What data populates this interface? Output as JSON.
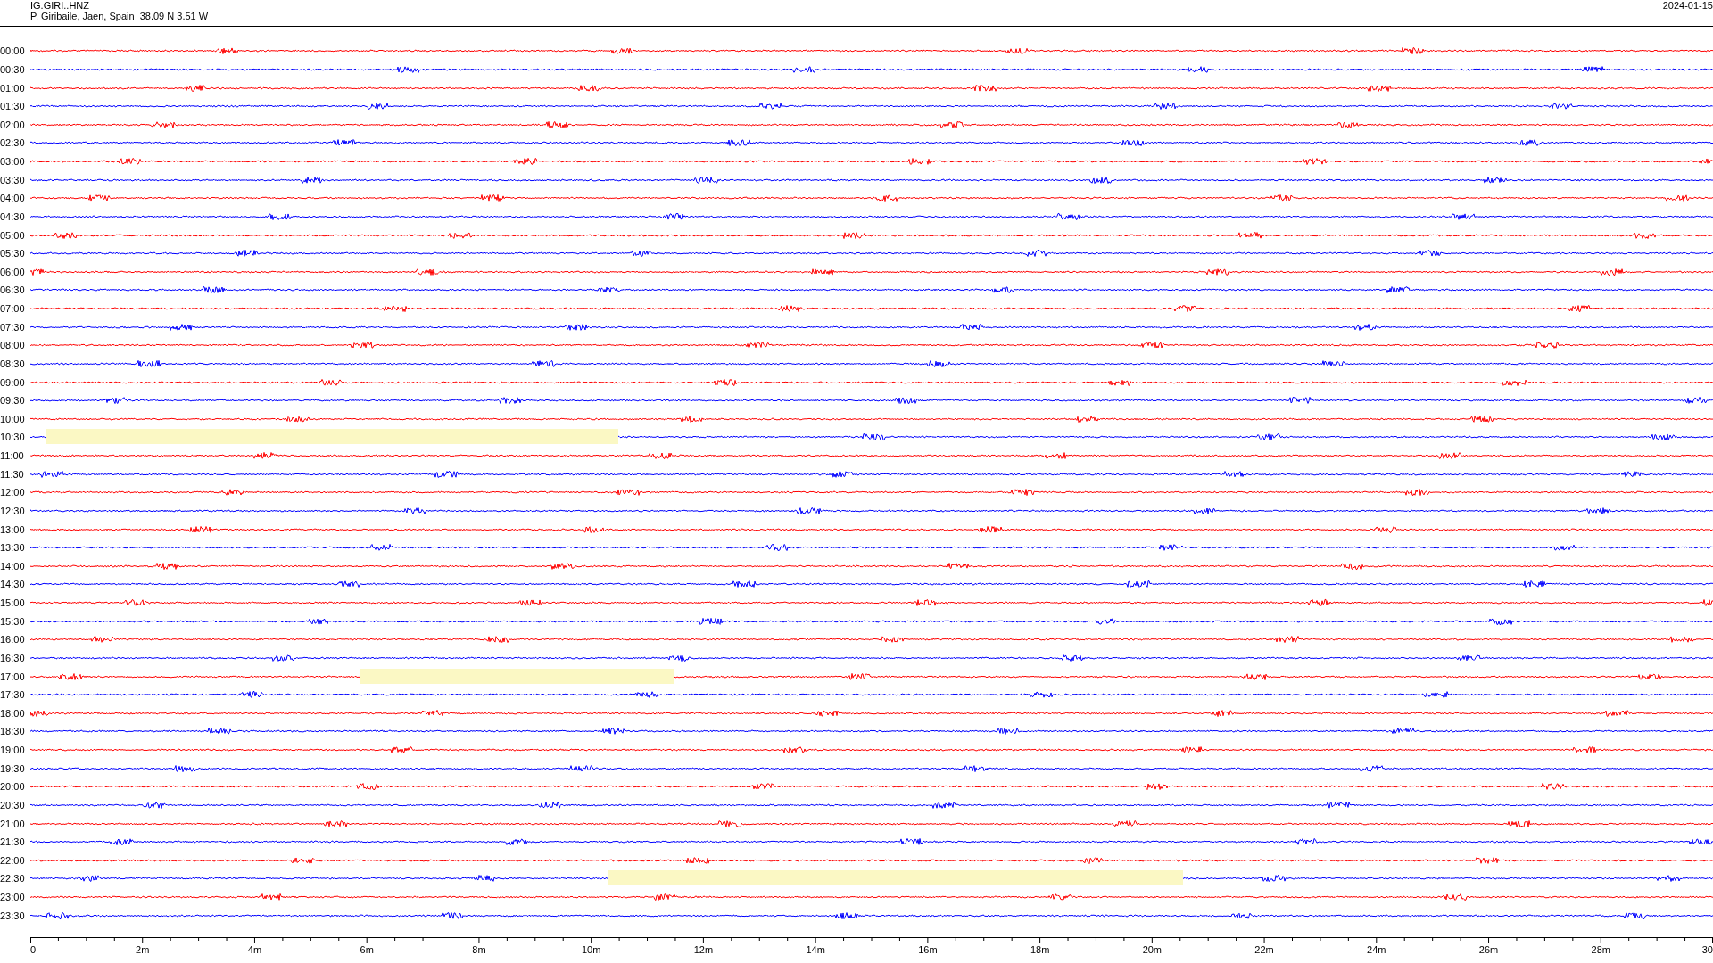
{
  "header": {
    "station": "IG.GIRI..HNZ",
    "location": "P. Giribaile, Jaen, Spain  38.09 N 3.51 W",
    "date": "2024-01-15"
  },
  "traces": [
    {
      "label": "00:00",
      "color": "#ff0000"
    },
    {
      "label": "00:30",
      "color": "#0000ff"
    },
    {
      "label": "01:00",
      "color": "#ff0000"
    },
    {
      "label": "01:30",
      "color": "#0000ff"
    },
    {
      "label": "02:00",
      "color": "#ff0000"
    },
    {
      "label": "02:30",
      "color": "#0000ff"
    },
    {
      "label": "03:00",
      "color": "#ff0000"
    },
    {
      "label": "03:30",
      "color": "#0000ff"
    },
    {
      "label": "04:00",
      "color": "#ff0000"
    },
    {
      "label": "04:30",
      "color": "#0000ff"
    },
    {
      "label": "05:00",
      "color": "#ff0000"
    },
    {
      "label": "05:30",
      "color": "#0000ff"
    },
    {
      "label": "06:00",
      "color": "#ff0000"
    },
    {
      "label": "06:30",
      "color": "#0000ff"
    },
    {
      "label": "07:00",
      "color": "#ff0000"
    },
    {
      "label": "07:30",
      "color": "#0000ff"
    },
    {
      "label": "08:00",
      "color": "#ff0000"
    },
    {
      "label": "08:30",
      "color": "#0000ff"
    },
    {
      "label": "09:00",
      "color": "#ff0000"
    },
    {
      "label": "09:30",
      "color": "#0000ff"
    },
    {
      "label": "10:00",
      "color": "#ff0000"
    },
    {
      "label": "10:30",
      "color": "#0000ff"
    },
    {
      "label": "11:00",
      "color": "#ff0000"
    },
    {
      "label": "11:30",
      "color": "#0000ff"
    },
    {
      "label": "12:00",
      "color": "#ff0000"
    },
    {
      "label": "12:30",
      "color": "#0000ff"
    },
    {
      "label": "13:00",
      "color": "#ff0000"
    },
    {
      "label": "13:30",
      "color": "#0000ff"
    },
    {
      "label": "14:00",
      "color": "#ff0000"
    },
    {
      "label": "14:30",
      "color": "#0000ff"
    },
    {
      "label": "15:00",
      "color": "#ff0000"
    },
    {
      "label": "15:30",
      "color": "#0000ff"
    },
    {
      "label": "16:00",
      "color": "#ff0000"
    },
    {
      "label": "16:30",
      "color": "#0000ff"
    },
    {
      "label": "17:00",
      "color": "#ff0000"
    },
    {
      "label": "17:30",
      "color": "#0000ff"
    },
    {
      "label": "18:00",
      "color": "#ff0000"
    },
    {
      "label": "18:30",
      "color": "#0000ff"
    },
    {
      "label": "19:00",
      "color": "#ff0000"
    },
    {
      "label": "19:30",
      "color": "#0000ff"
    },
    {
      "label": "20:00",
      "color": "#ff0000"
    },
    {
      "label": "20:30",
      "color": "#0000ff"
    },
    {
      "label": "21:00",
      "color": "#ff0000"
    },
    {
      "label": "21:30",
      "color": "#0000ff"
    },
    {
      "label": "22:00",
      "color": "#ff0000"
    },
    {
      "label": "22:30",
      "color": "#0000ff"
    },
    {
      "label": "23:00",
      "color": "#ff0000"
    },
    {
      "label": "23:30",
      "color": "#0000ff"
    }
  ],
  "time_axis": {
    "ticks": [
      "0",
      "2m",
      "4m",
      "6m",
      "8m",
      "10m",
      "12m",
      "14m",
      "16m",
      "18m",
      "20m",
      "22m",
      "24m",
      "26m",
      "28m",
      "30"
    ]
  }
}
